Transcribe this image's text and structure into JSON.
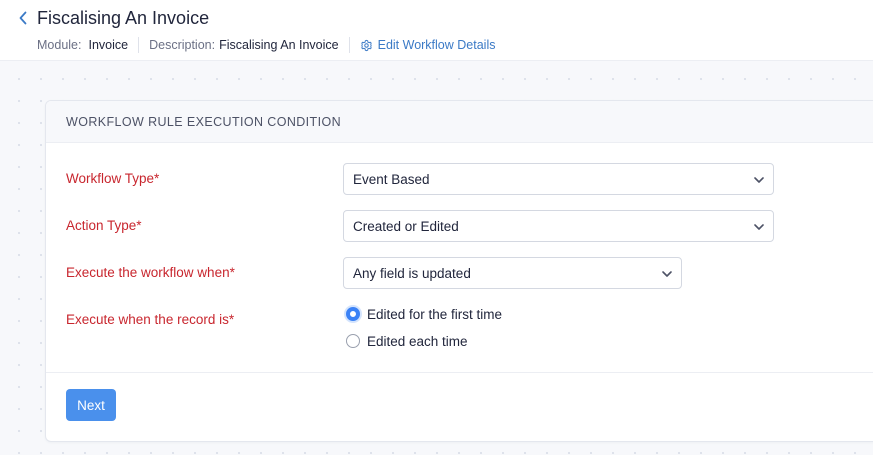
{
  "header": {
    "title": "Fiscalising An Invoice",
    "module_label": "Module:",
    "module_value": "Invoice",
    "description_label": "Description:",
    "description_value": "Fiscalising An Invoice",
    "edit_link": "Edit Workflow Details"
  },
  "card": {
    "title": "WORKFLOW RULE EXECUTION CONDITION",
    "fields": {
      "workflow_type": {
        "label": "Workflow Type*",
        "value": "Event Based"
      },
      "action_type": {
        "label": "Action Type*",
        "value": "Created or Edited"
      },
      "execute_when": {
        "label": "Execute the workflow when*",
        "value": "Any field is updated"
      },
      "record_is": {
        "label": "Execute when the record is*",
        "options": [
          {
            "label": "Edited for the first time",
            "selected": true
          },
          {
            "label": "Edited each time",
            "selected": false
          }
        ]
      }
    },
    "next_button": "Next"
  },
  "colors": {
    "accent": "#3b82f6",
    "button": "#4a90ec",
    "required_label": "#c8262e",
    "link": "#3b7ac6"
  },
  "icons": {
    "back": "chevron-left-icon",
    "edit": "gear-icon",
    "dropdown": "chevron-down-icon"
  }
}
